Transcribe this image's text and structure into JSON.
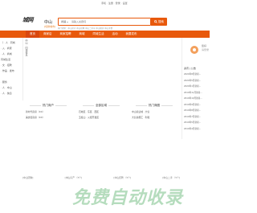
{
  "topbar": {
    "links": "手机 · 注册 · 登录 · 设置"
  },
  "header": {
    "logo_text": "城网",
    "city": "中山",
    "city_switch": "[切换城市]",
    "search_select": "商铺",
    "search_placeholder": "请输入关键词",
    "search_button": "搜索",
    "hot_words": "热门搜索：中山房产 中山招聘 中山二手车 中山租房 中山美食"
  },
  "nav": {
    "items": [
      "首页",
      "商家店",
      "商家招聘",
      "商城",
      "同城生活",
      "活动",
      "我要发布"
    ]
  },
  "left_col": {
    "lines": [
      "（ · 人 · 同城",
      "· 入 · 商家",
      "· 人 · 商城",
      "同城生活",
      "· 文 · 招聘",
      "· 作品 · 发布",
      "",
      "· 服务",
      "· 人 · 中山",
      "· 人 · 信息"
    ]
  },
  "slide": {
    "vertical_text": "中山 · 同城信息"
  },
  "right_panel": {
    "hello": "您好",
    "login": "请登录",
    "news_title": "资讯 | 公告",
    "news": [
      "2020年8月新闻...",
      "2020年5月新闻...",
      "2020年1月新闻...",
      "2019年11月新闻...",
      "2019年10月新闻...",
      "2019年9月新闻...",
      "2019年8月新闻...",
      "2019年7月新闻...",
      "2019年5月新闻...",
      "2019年4月新闻..."
    ]
  },
  "boxes": [
    {
      "title": "热门商户",
      "rows": [
        "新时代商家（XX）",
        "美食街商家（XX）"
      ]
    },
    {
      "title": "全部区域",
      "rows": [
        "石岐区 · 东区 · 西区",
        "五桂山 · 火炬开发区"
      ]
    },
    {
      "title": "热门商圈",
      "rows": [
        "中山商业城 · 大信",
        "大信新都汇 · 利和"
      ]
    }
  ],
  "footer_links": [
    "[中山团购]",
    "[中山房产 （5个]",
    "[中山招聘 （5个]",
    "[中山二手 （5个]"
  ],
  "watermark": "免费自动收录"
}
